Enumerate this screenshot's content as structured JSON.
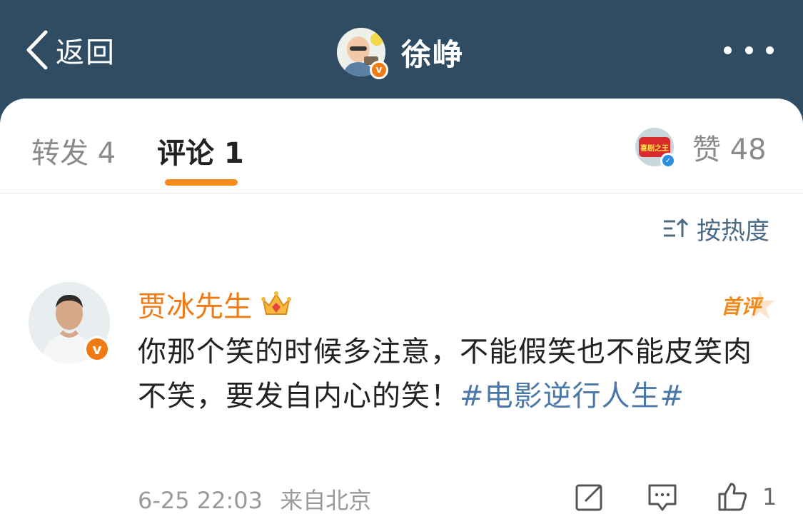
{
  "header": {
    "back_label": "返回",
    "profile_name": "徐峥"
  },
  "tabs": {
    "repost_label": "转发 4",
    "comment_label": "评论 1",
    "likes_label": "赞 48",
    "liker_avatar_text": "喜剧之王"
  },
  "sort": {
    "label": "按热度"
  },
  "comment": {
    "author": "贾冰先生",
    "badge": "首评",
    "text": "你那个笑的时候多注意，不能假笑也不能皮笑肉不笑，要发自内心的笑！",
    "hashtag": "#电影逆行人生#",
    "time": "6-25 22:03",
    "source": "来自北京",
    "like_count": "1"
  },
  "colors": {
    "header_bg": "#2f4c62",
    "accent_orange": "#f78a1c",
    "link_blue": "#4a78a8"
  }
}
